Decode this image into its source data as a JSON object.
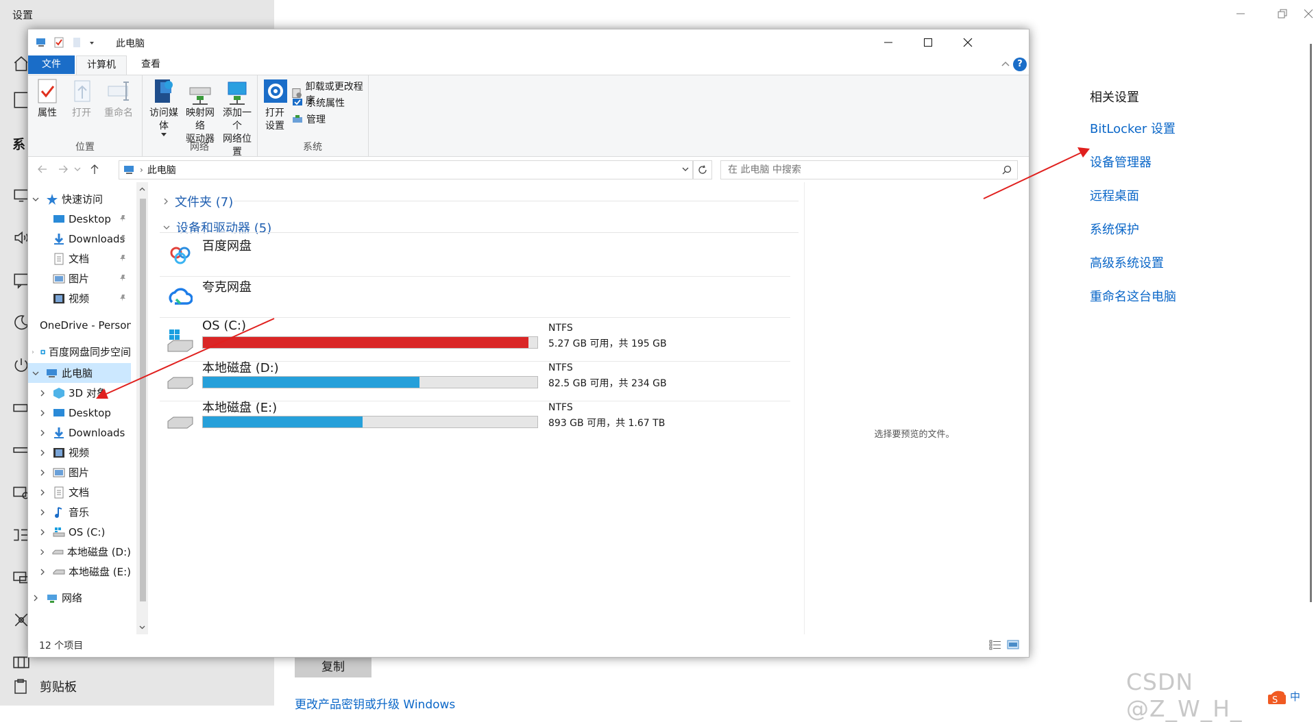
{
  "settings": {
    "window_title": "设置",
    "sidebar_letter": "系",
    "clipboard_label": "剪贴板",
    "related": {
      "title": "相关设置",
      "links": [
        "BitLocker 设置",
        "设备管理器",
        "远程桌面",
        "系统保护",
        "高级系统设置",
        "重命名这台电脑"
      ]
    },
    "copy_button": "复制",
    "upgrade_link": "更改产品密钥或升级 Windows"
  },
  "watermark": "CSDN @Z_W_H_",
  "ime_label": "中",
  "explorer": {
    "title": "此电脑",
    "tabs": [
      "文件",
      "计算机",
      "查看"
    ],
    "help": "?",
    "ribbon": {
      "location": {
        "label": "位置",
        "buttons": [
          "属性",
          "打开",
          "重命名"
        ]
      },
      "network": {
        "label": "网络",
        "access_media": [
          "访问媒体"
        ],
        "map_drive": [
          "映射网络",
          "驱动器"
        ],
        "add_location": [
          "添加一个",
          "网络位置"
        ]
      },
      "system": {
        "label": "系统",
        "open_settings": [
          "打开",
          "设置"
        ],
        "items": [
          "卸载或更改程序",
          "系统属性",
          "管理"
        ]
      }
    },
    "address": {
      "path": "此电脑",
      "search_placeholder": "在 此电脑 中搜索"
    },
    "nav": {
      "quick_access": "快速访问",
      "quick_items": [
        "Desktop",
        "Downloads",
        "文档",
        "图片",
        "视频"
      ],
      "onedrive": "OneDrive - Personal",
      "baidu_sync": "百度网盘同步空间",
      "this_pc": "此电脑",
      "pc_items": [
        "3D 对象",
        "Desktop",
        "Downloads",
        "视频",
        "图片",
        "文档",
        "音乐",
        "OS (C:)",
        "本地磁盘 (D:)",
        "本地磁盘 (E:)"
      ],
      "network": "网络"
    },
    "content": {
      "folders_header": "文件夹 (7)",
      "devices_header": "设备和驱动器 (5)",
      "apps": [
        "百度网盘",
        "夸克网盘"
      ],
      "drives": [
        {
          "name": "OS (C:)",
          "fs": "NTFS",
          "space": "5.27 GB 可用，共 195 GB",
          "used_fraction": 0.973,
          "color": "#da2626"
        },
        {
          "name": "本地磁盘 (D:)",
          "fs": "NTFS",
          "space": "82.5 GB 可用，共 234 GB",
          "used_fraction": 0.647,
          "color": "#26a0da"
        },
        {
          "name": "本地磁盘 (E:)",
          "fs": "NTFS",
          "space": "893 GB 可用，共 1.67 TB",
          "used_fraction": 0.478,
          "color": "#26a0da"
        }
      ]
    },
    "preview_text": "选择要预览的文件。",
    "status": "12 个项目"
  },
  "colors": {
    "accent": "#1a6dc8",
    "link": "#0b67c8",
    "selected": "#cce8ff",
    "annotation_arrow": "#e0201e"
  }
}
